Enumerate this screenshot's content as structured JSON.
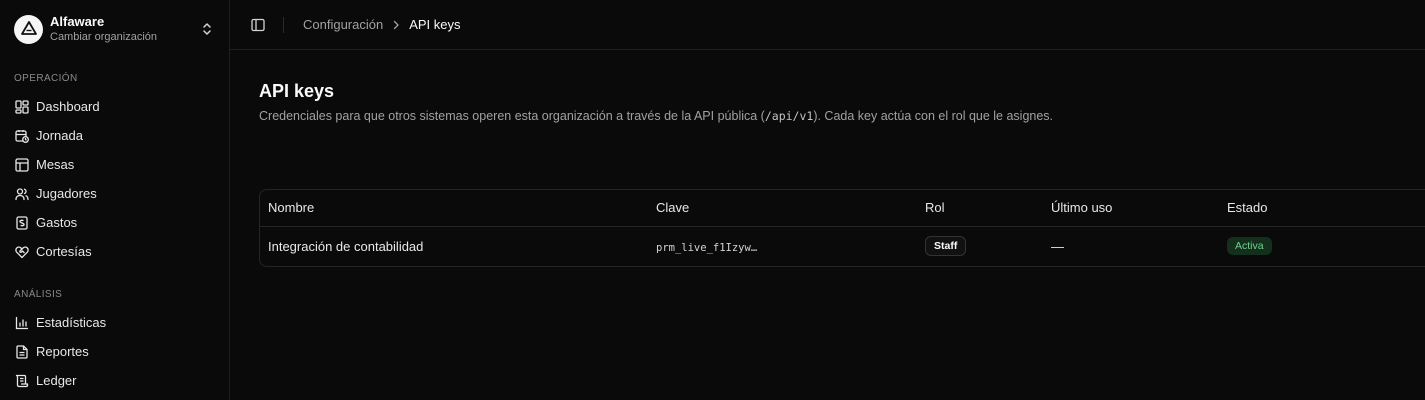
{
  "org": {
    "name": "Alfaware",
    "subtitle": "Cambiar organización",
    "logo_text": "ALFAWARE"
  },
  "sidebar": {
    "sections": [
      {
        "label": "OPERACIÓN",
        "items": [
          {
            "label": "Dashboard",
            "icon": "dashboard-icon"
          },
          {
            "label": "Jornada",
            "icon": "calendar-clock-icon"
          },
          {
            "label": "Mesas",
            "icon": "table-icon"
          },
          {
            "label": "Jugadores",
            "icon": "users-icon"
          },
          {
            "label": "Gastos",
            "icon": "receipt-icon"
          },
          {
            "label": "Cortesías",
            "icon": "heart-handshake-icon"
          }
        ]
      },
      {
        "label": "ANÁLISIS",
        "items": [
          {
            "label": "Estadísticas",
            "icon": "bar-chart-icon"
          },
          {
            "label": "Reportes",
            "icon": "file-text-icon"
          },
          {
            "label": "Ledger",
            "icon": "scroll-icon"
          }
        ]
      }
    ]
  },
  "breadcrumb": {
    "parent": "Configuración",
    "current": "API keys"
  },
  "page": {
    "title": "API keys",
    "desc_before": "Credenciales para que otros sistemas operen esta organización a través de la API pública (",
    "desc_code": "/api/v1",
    "desc_after": "). Cada key actúa con el rol que le asignes."
  },
  "table": {
    "headers": [
      "Nombre",
      "Clave",
      "Rol",
      "Último uso",
      "Estado"
    ],
    "rows": [
      {
        "name": "Integración de contabilidad",
        "key": "prm_live_f1Izyw…",
        "role": "Staff",
        "last_used": "—",
        "status": "Activa"
      }
    ]
  },
  "colors": {
    "background": "#0a0a0a",
    "border": "#262626",
    "muted_text": "#a1a1a1",
    "status_active_bg": "#14301d",
    "status_active_text": "#6fd08c"
  }
}
